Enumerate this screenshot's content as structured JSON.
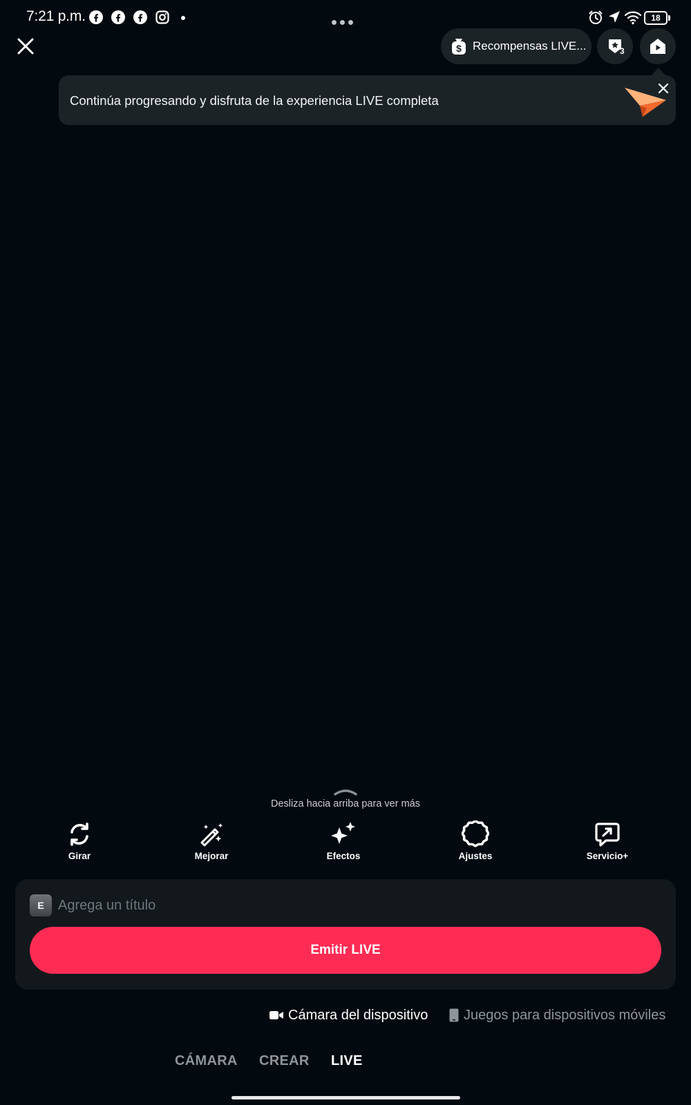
{
  "status_bar": {
    "time": "7:21 p.m.",
    "battery": "18",
    "notification_icons": [
      "facebook-icon",
      "facebook-icon",
      "facebook-icon",
      "instagram-icon"
    ]
  },
  "header": {
    "rewards_label": "Recompensas LIVE...",
    "rank_count": "3"
  },
  "tooltip": {
    "text": "Continúa progresando y disfruta de la experiencia LIVE completa"
  },
  "swipe_hint": "Desliza hacia arriba para ver más",
  "tools": [
    {
      "label": "Girar",
      "icon": "flip-camera-icon"
    },
    {
      "label": "Mejorar",
      "icon": "magic-wand-icon"
    },
    {
      "label": "Efectos",
      "icon": "sparkles-icon"
    },
    {
      "label": "Ajustes",
      "icon": "settings-gear-icon"
    },
    {
      "label": "Servicio+",
      "icon": "chat-arrow-icon"
    }
  ],
  "go_live": {
    "title_badge": "E",
    "title_placeholder": "Agrega un título",
    "button_label": "Emitir LIVE"
  },
  "sources": {
    "camera": "Cámara del dispositivo",
    "games": "Juegos para dispositivos móviles"
  },
  "mode_tabs": [
    "CÁMARA",
    "CREAR",
    "LIVE"
  ],
  "colors": {
    "background": "#020a10",
    "accent": "#fe2c55",
    "surface": "#1c2327"
  }
}
